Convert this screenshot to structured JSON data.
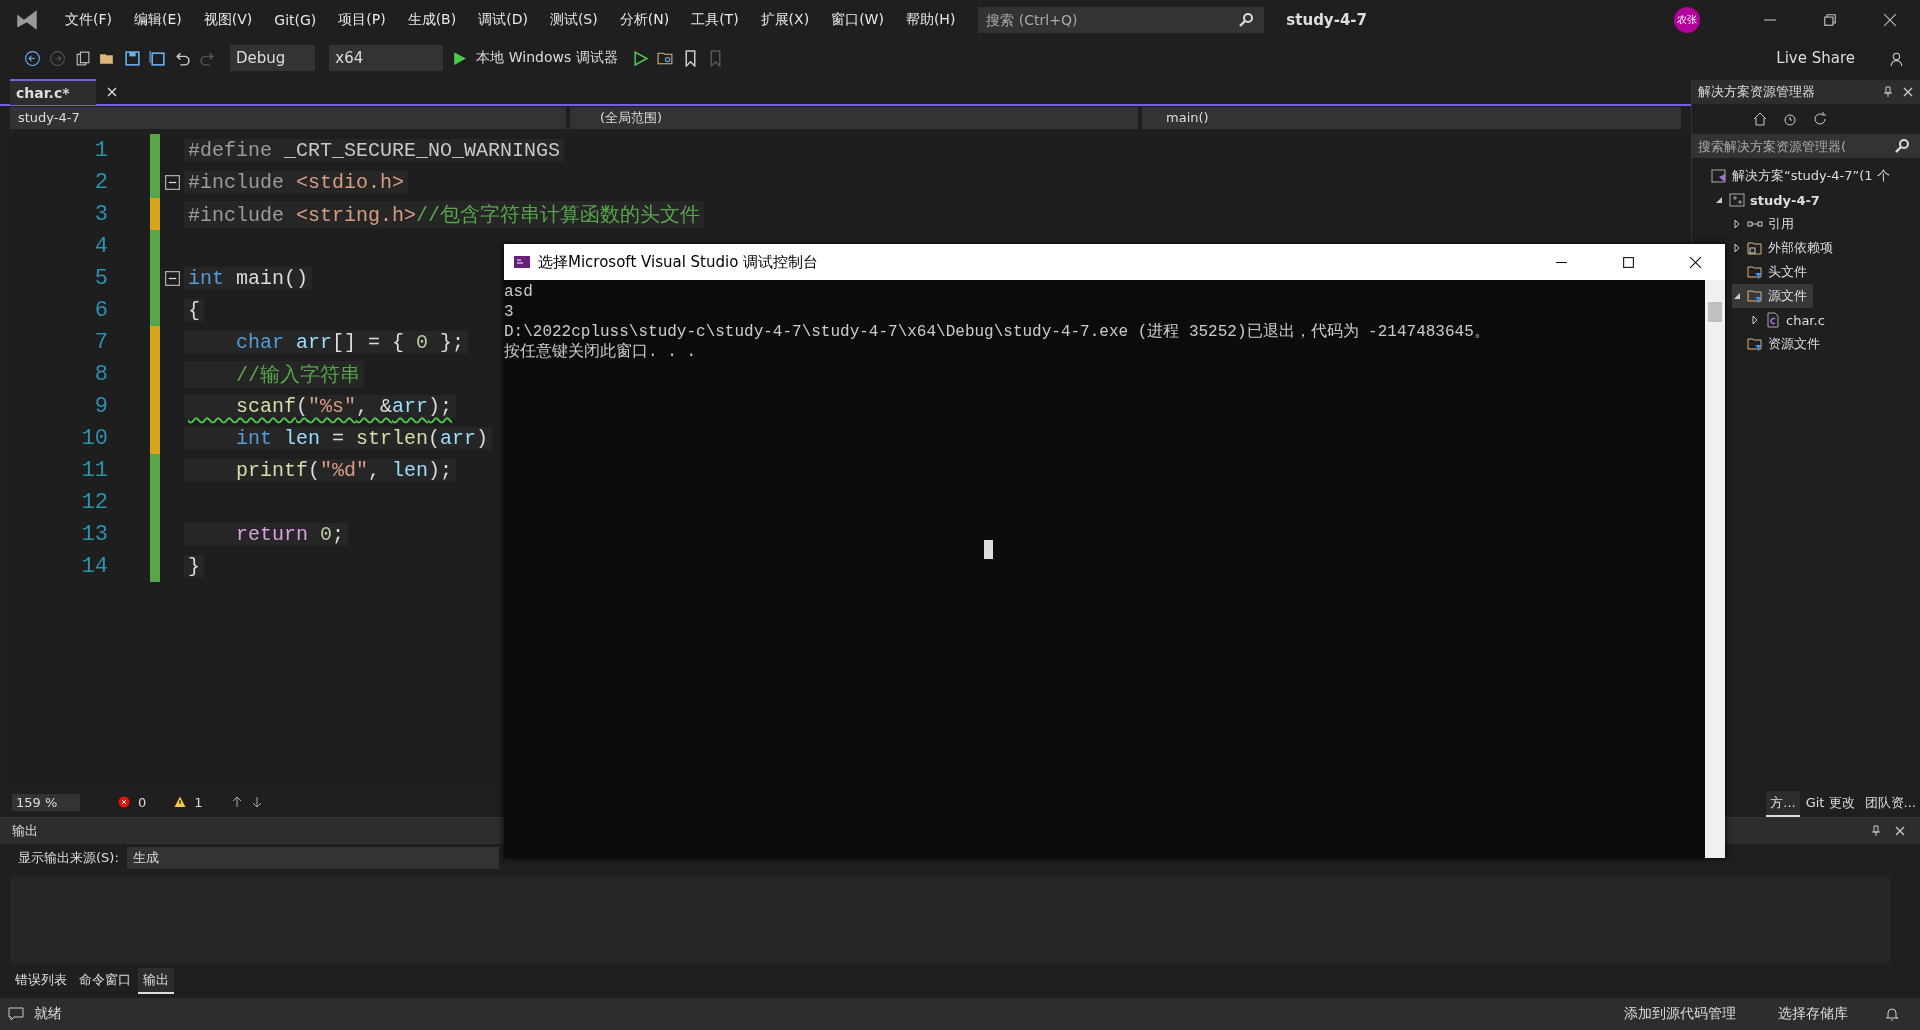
{
  "menu": [
    "文件(F)",
    "编辑(E)",
    "视图(V)",
    "Git(G)",
    "项目(P)",
    "生成(B)",
    "调试(D)",
    "测试(S)",
    "分析(N)",
    "工具(T)",
    "扩展(X)",
    "窗口(W)",
    "帮助(H)"
  ],
  "search": {
    "placeholder": "搜索 (Ctrl+Q)"
  },
  "window": {
    "title": "study-4-7",
    "avatar": "农张"
  },
  "toolbar": {
    "configuration": "Debug",
    "platform": "x64",
    "run_label": "本地 Windows 调试器",
    "live_share": "Live Share"
  },
  "doc_tabs": [
    {
      "label": "char.c*",
      "selected": true
    }
  ],
  "nav_bar": {
    "project": "study-4-7",
    "scope": "(全局范围)",
    "member": "main()"
  },
  "editor": {
    "lines": [
      {
        "number": "1",
        "color": "#57a64a",
        "fold": false,
        "tokens": [
          {
            "t": "#define",
            "kind": "pre"
          },
          {
            "t": " _CRT_SECURE_NO_WARNINGS",
            "kind": "macro"
          }
        ]
      },
      {
        "number": "2",
        "color": "#57a64a",
        "fold": true,
        "tokens": [
          {
            "t": "#include",
            "kind": "pre"
          },
          {
            "t": " <stdio.h>",
            "kind": "str"
          }
        ]
      },
      {
        "number": "3",
        "color": "#d6a61d",
        "fold": false,
        "tokens": [
          {
            "t": "#include",
            "kind": "pre"
          },
          {
            "t": " <string.h>",
            "kind": "str"
          },
          {
            "t": "//包含字符串计算函数的头文件",
            "kind": "comment"
          }
        ]
      },
      {
        "number": "4",
        "color": "#57a64a",
        "fold": false
      },
      {
        "number": "5",
        "color": "#57a64a",
        "fold": true,
        "tokens": [
          {
            "t": "int",
            "kind": "kw"
          },
          {
            "t": " main()",
            "kind": "plain"
          }
        ]
      },
      {
        "number": "6",
        "color": "#57a64a",
        "fold": false,
        "tokens": [
          {
            "t": "{",
            "kind": "plain"
          }
        ]
      },
      {
        "number": "7",
        "color": "#d6a61d",
        "fold": false,
        "tokens": [
          {
            "t": "    char",
            "kind": "kw"
          },
          {
            "t": " arr",
            "kind": "var"
          },
          {
            "t": "[] = { ",
            "kind": "plain"
          },
          {
            "t": "0",
            "kind": "num"
          },
          {
            "t": " };",
            "kind": "plain"
          }
        ]
      },
      {
        "number": "8",
        "color": "#d6a61d",
        "fold": false,
        "tokens": [
          {
            "t": "    //输入字符串",
            "kind": "comment"
          }
        ]
      },
      {
        "number": "9",
        "color": "#d6a61d",
        "fold": false,
        "warning": true,
        "tokens": [
          {
            "t": "    scanf",
            "kind": "func"
          },
          {
            "t": "(",
            "kind": "plain"
          },
          {
            "t": "\"%s\"",
            "kind": "str"
          },
          {
            "t": ", &",
            "kind": "plain"
          },
          {
            "t": "arr",
            "kind": "var"
          },
          {
            "t": ");",
            "kind": "plain"
          }
        ]
      },
      {
        "number": "10",
        "color": "#d6a61d",
        "fold": false,
        "tokens": [
          {
            "t": "    int",
            "kind": "kw"
          },
          {
            "t": " len",
            "kind": "var"
          },
          {
            "t": " = ",
            "kind": "plain"
          },
          {
            "t": "strlen",
            "kind": "func"
          },
          {
            "t": "(",
            "kind": "plain"
          },
          {
            "t": "arr",
            "kind": "var"
          },
          {
            "t": ")",
            "kind": "plain"
          }
        ]
      },
      {
        "number": "11",
        "color": "#57a64a",
        "fold": false,
        "tokens": [
          {
            "t": "    printf",
            "kind": "func"
          },
          {
            "t": "(",
            "kind": "plain"
          },
          {
            "t": "\"%d\"",
            "kind": "str"
          },
          {
            "t": ", ",
            "kind": "plain"
          },
          {
            "t": "len",
            "kind": "var"
          },
          {
            "t": ");",
            "kind": "plain"
          }
        ]
      },
      {
        "number": "12",
        "color": "#57a64a",
        "fold": false
      },
      {
        "number": "13",
        "color": "#57a64a",
        "fold": false,
        "tokens": [
          {
            "t": "    return",
            "kind": "ctrl"
          },
          {
            "t": " 0",
            "kind": "num"
          },
          {
            "t": ";",
            "kind": "plain"
          }
        ]
      },
      {
        "number": "14",
        "color": "#57a64a",
        "fold": false,
        "tokens": [
          {
            "t": "}",
            "kind": "plain"
          }
        ]
      }
    ]
  },
  "editor_status": {
    "zoom": "159 %",
    "errors": "0",
    "warnings": "1"
  },
  "solution_explorer": {
    "title": "解决方案资源管理器",
    "search": {
      "placeholder": "搜索解决方案资源管理器("
    },
    "tree": [
      {
        "label": "解决方案“study-4-7”(1 个",
        "kind": "solution",
        "selected": false,
        "children": [
          {
            "label": "study-4-7",
            "kind": "project",
            "expanded": true,
            "selected": false,
            "children": [
              {
                "label": "引用",
                "kind": "references",
                "expanded": false,
                "selected": false
              },
              {
                "label": "外部依赖项",
                "kind": "external",
                "expanded": false,
                "selected": false
              },
              {
                "label": "头文件",
                "kind": "filter",
                "selected": false
              },
              {
                "label": "源文件",
                "kind": "filter",
                "expanded": true,
                "selected": true,
                "children": [
                  {
                    "label": "char.c",
                    "kind": "cfile",
                    "expanded": false,
                    "selected": false
                  }
                ]
              },
              {
                "label": "资源文件",
                "kind": "filter",
                "selected": false
              }
            ]
          }
        ]
      }
    ],
    "tabs": [
      {
        "label": "方...",
        "selected": true
      },
      {
        "label": "Git 更改",
        "selected": false
      },
      {
        "label": "团队资...",
        "selected": false
      }
    ]
  },
  "output": {
    "title": "输出",
    "source_label": "显示输出来源(S):",
    "source": "生成"
  },
  "bottom_tabs": [
    {
      "label": "错误列表",
      "selected": false
    },
    {
      "label": "命令窗口",
      "selected": false
    },
    {
      "label": "输出",
      "selected": true
    }
  ],
  "status_bar": {
    "message": "就绪",
    "source_control": "添加到源代码管理",
    "repository": "选择存储库"
  },
  "console": {
    "title": "选择Microsoft Visual Studio 调试控制台",
    "lines": [
      "asd",
      "3",
      "D:\\2022cpluss\\study-c\\study-4-7\\study-4-7\\x64\\Debug\\study-4-7.exe (进程 35252)已退出，代码为 -2147483645。",
      "按任意键关闭此窗口. . ."
    ]
  }
}
